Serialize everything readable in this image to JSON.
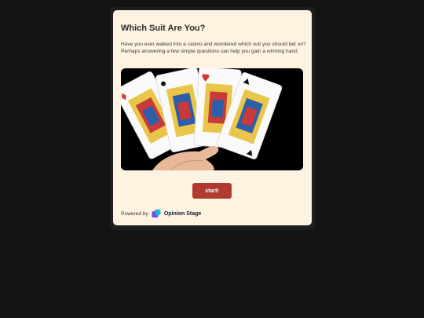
{
  "quiz": {
    "title": "Which Suit Are You?",
    "description": "Have you ever walked into a casino and wondered which suit you should bet on? Perhaps answering a few simple questions can help you gain a winning hand.",
    "start_label": "start!",
    "image_content": "four-queens-cards-in-hand"
  },
  "footer": {
    "powered_by": "Powered by",
    "brand": "Opinion Stage",
    "logo_icon": "opinion-stage-logo-icon"
  },
  "colors": {
    "background": "#141414",
    "card": "#fdf3e0",
    "button": "#b03a2e",
    "button_text": "#ffffff"
  }
}
